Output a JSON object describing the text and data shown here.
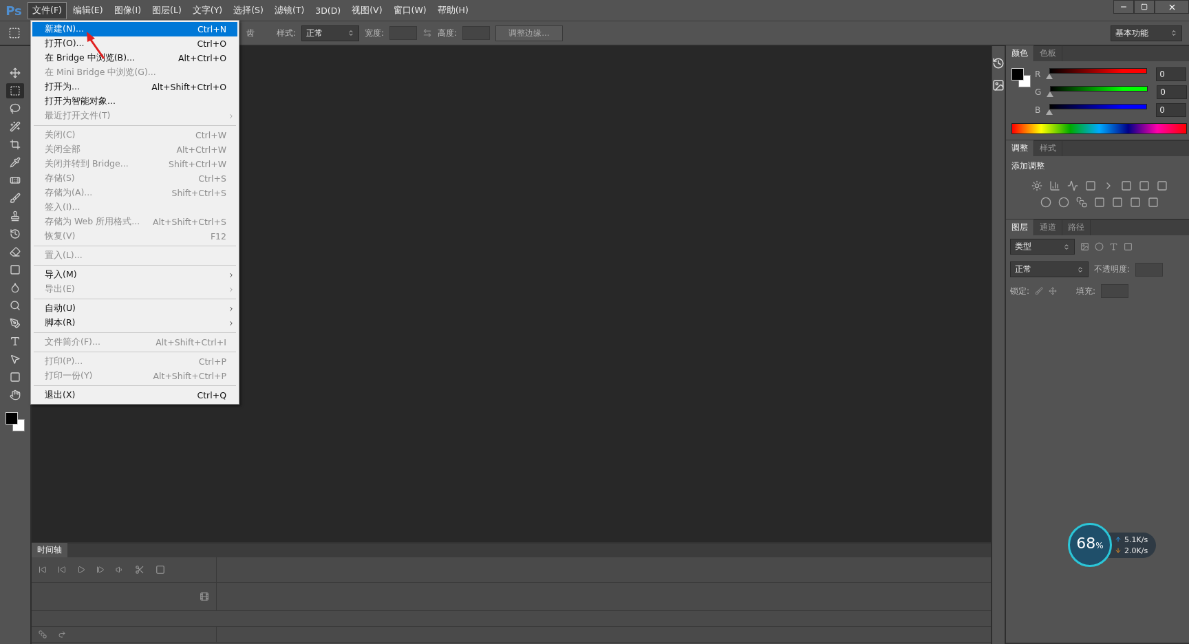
{
  "app": {
    "logo": "Ps"
  },
  "menubar": [
    {
      "label": "文件(F)",
      "selected": true
    },
    {
      "label": "编辑(E)",
      "selected": false
    },
    {
      "label": "图像(I)",
      "selected": false
    },
    {
      "label": "图层(L)",
      "selected": false
    },
    {
      "label": "文字(Y)",
      "selected": false
    },
    {
      "label": "选择(S)",
      "selected": false
    },
    {
      "label": "滤镜(T)",
      "selected": false
    },
    {
      "label": "3D(D)",
      "selected": false
    },
    {
      "label": "视图(V)",
      "selected": false
    },
    {
      "label": "窗口(W)",
      "selected": false
    },
    {
      "label": "帮助(H)",
      "selected": false
    }
  ],
  "options_bar": {
    "cut_label": "齿",
    "style_label": "样式:",
    "style_value": "正常",
    "width_label": "宽度:",
    "height_label": "高度:",
    "refine_button": "调整边缘...",
    "workspace": "基本功能"
  },
  "file_menu": [
    {
      "kind": "item",
      "label": "新建(N)...",
      "shortcut": "Ctrl+N",
      "disabled": false,
      "selected": true,
      "submenu": false
    },
    {
      "kind": "item",
      "label": "打开(O)...",
      "shortcut": "Ctrl+O",
      "disabled": false,
      "selected": false,
      "submenu": false
    },
    {
      "kind": "item",
      "label": "在 Bridge 中浏览(B)...",
      "shortcut": "Alt+Ctrl+O",
      "disabled": false,
      "selected": false,
      "submenu": false
    },
    {
      "kind": "item",
      "label": "在 Mini Bridge 中浏览(G)...",
      "disabled": true,
      "selected": false,
      "submenu": false
    },
    {
      "kind": "item",
      "label": "打开为...",
      "shortcut": "Alt+Shift+Ctrl+O",
      "disabled": false,
      "selected": false,
      "submenu": false
    },
    {
      "kind": "item",
      "label": "打开为智能对象...",
      "disabled": false,
      "selected": false,
      "submenu": false
    },
    {
      "kind": "item",
      "label": "最近打开文件(T)",
      "disabled": true,
      "selected": false,
      "submenu": true
    },
    {
      "kind": "separator"
    },
    {
      "kind": "item",
      "label": "关闭(C)",
      "shortcut": "Ctrl+W",
      "disabled": true,
      "selected": false,
      "submenu": false
    },
    {
      "kind": "item",
      "label": "关闭全部",
      "shortcut": "Alt+Ctrl+W",
      "disabled": true,
      "selected": false,
      "submenu": false
    },
    {
      "kind": "item",
      "label": "关闭并转到 Bridge...",
      "shortcut": "Shift+Ctrl+W",
      "disabled": true,
      "selected": false,
      "submenu": false
    },
    {
      "kind": "item",
      "label": "存储(S)",
      "shortcut": "Ctrl+S",
      "disabled": true,
      "selected": false,
      "submenu": false
    },
    {
      "kind": "item",
      "label": "存储为(A)...",
      "shortcut": "Shift+Ctrl+S",
      "disabled": true,
      "selected": false,
      "submenu": false
    },
    {
      "kind": "item",
      "label": "签入(I)...",
      "disabled": true,
      "selected": false,
      "submenu": false
    },
    {
      "kind": "item",
      "label": "存储为 Web 所用格式...",
      "shortcut": "Alt+Shift+Ctrl+S",
      "disabled": true,
      "selected": false,
      "submenu": false
    },
    {
      "kind": "item",
      "label": "恢复(V)",
      "shortcut": "F12",
      "disabled": true,
      "selected": false,
      "submenu": false
    },
    {
      "kind": "separator"
    },
    {
      "kind": "item",
      "label": "置入(L)...",
      "disabled": true,
      "selected": false,
      "submenu": false
    },
    {
      "kind": "separator"
    },
    {
      "kind": "item",
      "label": "导入(M)",
      "disabled": false,
      "selected": false,
      "submenu": true
    },
    {
      "kind": "item",
      "label": "导出(E)",
      "disabled": true,
      "selected": false,
      "submenu": true
    },
    {
      "kind": "separator"
    },
    {
      "kind": "item",
      "label": "自动(U)",
      "disabled": false,
      "selected": false,
      "submenu": true
    },
    {
      "kind": "item",
      "label": "脚本(R)",
      "disabled": false,
      "selected": false,
      "submenu": true
    },
    {
      "kind": "separator"
    },
    {
      "kind": "item",
      "label": "文件简介(F)...",
      "shortcut": "Alt+Shift+Ctrl+I",
      "disabled": true,
      "selected": false,
      "submenu": false
    },
    {
      "kind": "separator"
    },
    {
      "kind": "item",
      "label": "打印(P)...",
      "shortcut": "Ctrl+P",
      "disabled": true,
      "selected": false,
      "submenu": false
    },
    {
      "kind": "item",
      "label": "打印一份(Y)",
      "shortcut": "Alt+Shift+Ctrl+P",
      "disabled": true,
      "selected": false,
      "submenu": false
    },
    {
      "kind": "separator"
    },
    {
      "kind": "item",
      "label": "退出(X)",
      "shortcut": "Ctrl+Q",
      "disabled": false,
      "selected": false,
      "submenu": false
    }
  ],
  "tools": [
    {
      "selected": false
    },
    {
      "selected": true
    },
    {
      "selected": false
    },
    {
      "selected": false
    },
    {
      "selected": false
    },
    {
      "selected": false
    },
    {
      "selected": false
    },
    {
      "selected": false
    },
    {
      "selected": false
    },
    {
      "selected": false
    },
    {
      "selected": false
    },
    {
      "selected": false
    },
    {
      "selected": false
    },
    {
      "selected": false
    },
    {
      "selected": false
    },
    {
      "selected": false
    },
    {
      "selected": false
    },
    {
      "selected": false
    },
    {
      "selected": false
    }
  ],
  "color_panel": {
    "tabs": [
      {
        "label": "颜色",
        "selected": true
      },
      {
        "label": "色板",
        "selected": false
      }
    ],
    "channels": [
      {
        "name": "R",
        "color": "#ff0000",
        "level": 0,
        "value": "0"
      },
      {
        "name": "G",
        "color": "#00ff00",
        "level": 0,
        "value": "0"
      },
      {
        "name": "B",
        "color": "#0000ff",
        "level": 0,
        "value": "0"
      }
    ]
  },
  "adjust_panel": {
    "tabs": [
      {
        "label": "调整",
        "selected": true
      },
      {
        "label": "样式",
        "selected": false
      }
    ],
    "heading": "添加调整"
  },
  "layers_panel": {
    "tabs": [
      {
        "label": "图层",
        "selected": true
      },
      {
        "label": "通道",
        "selected": false
      },
      {
        "label": "路径",
        "selected": false
      }
    ],
    "filter": "类型",
    "blend": "正常",
    "opacity_label": "不透明度:",
    "lock_label": "锁定:",
    "fill_label": "填充:"
  },
  "timeline": {
    "tab": "时间轴"
  },
  "speed_widget": {
    "percent": "68",
    "unit": "%",
    "upload": "5.1K/s",
    "download": "2.0K/s"
  }
}
